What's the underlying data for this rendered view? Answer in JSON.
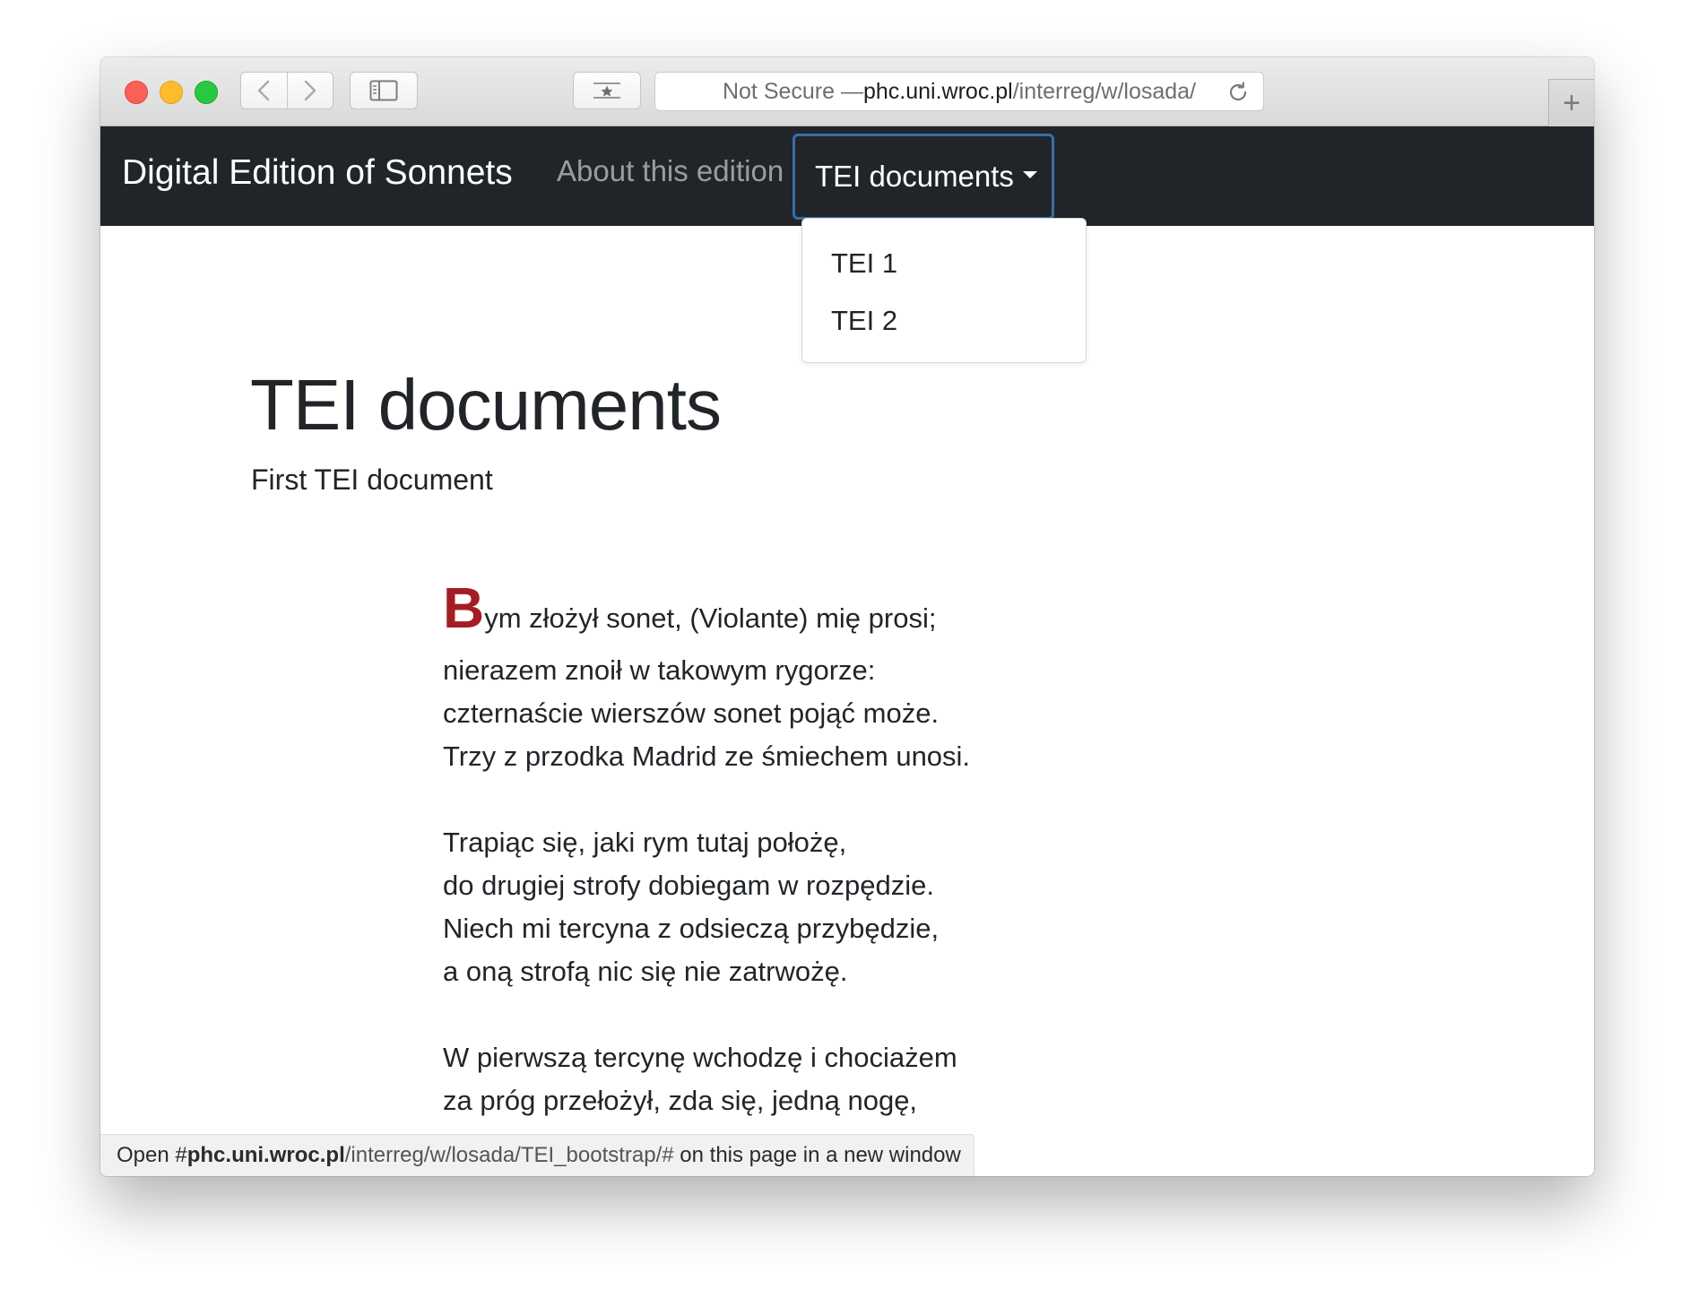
{
  "browser": {
    "favorites_icon": "star-icon",
    "address": {
      "prefix": "Not Secure — ",
      "host": "phc.uni.wroc.pl",
      "path": "/interreg/w/losada/"
    },
    "new_tab_label": "+"
  },
  "navbar": {
    "brand": "Digital Edition of Sonnets",
    "about_label": "About this edition",
    "tei_label": "TEI documents"
  },
  "dropdown": {
    "items": [
      {
        "label": "TEI 1"
      },
      {
        "label": "TEI 2"
      }
    ]
  },
  "page": {
    "title": "TEI documents",
    "subtitle": "First TEI document"
  },
  "poem": {
    "dropcap": "B",
    "first_line_rest": "ym złożył sonet, (Violante) mię prosi;",
    "stanza1": [
      "nierazem znoił w takowym rygorze:",
      "czternaście wierszów sonet pojąć może.",
      "Trzy z przodka Madrid ze śmiechem unosi."
    ],
    "stanza2": [
      "Trapiąc się, jaki rym tutaj położę,",
      "do drugiej strofy dobiegam w rozpędzie.",
      "Niech mi tercyna z odsieczą przybędzie,",
      "a oną strofą nic się nie zatrwożę."
    ],
    "stanza3": [
      "W pierwszą tercynę wchodzę i chociażem",
      "za próg przełożył, zda się, jedną nogę,"
    ]
  },
  "status": {
    "prefix": "Open #",
    "host": "phc.uni.wroc.pl",
    "path": "/interreg/w/losada/TEI_bootstrap/#",
    "suffix": " on this page in a new window"
  }
}
